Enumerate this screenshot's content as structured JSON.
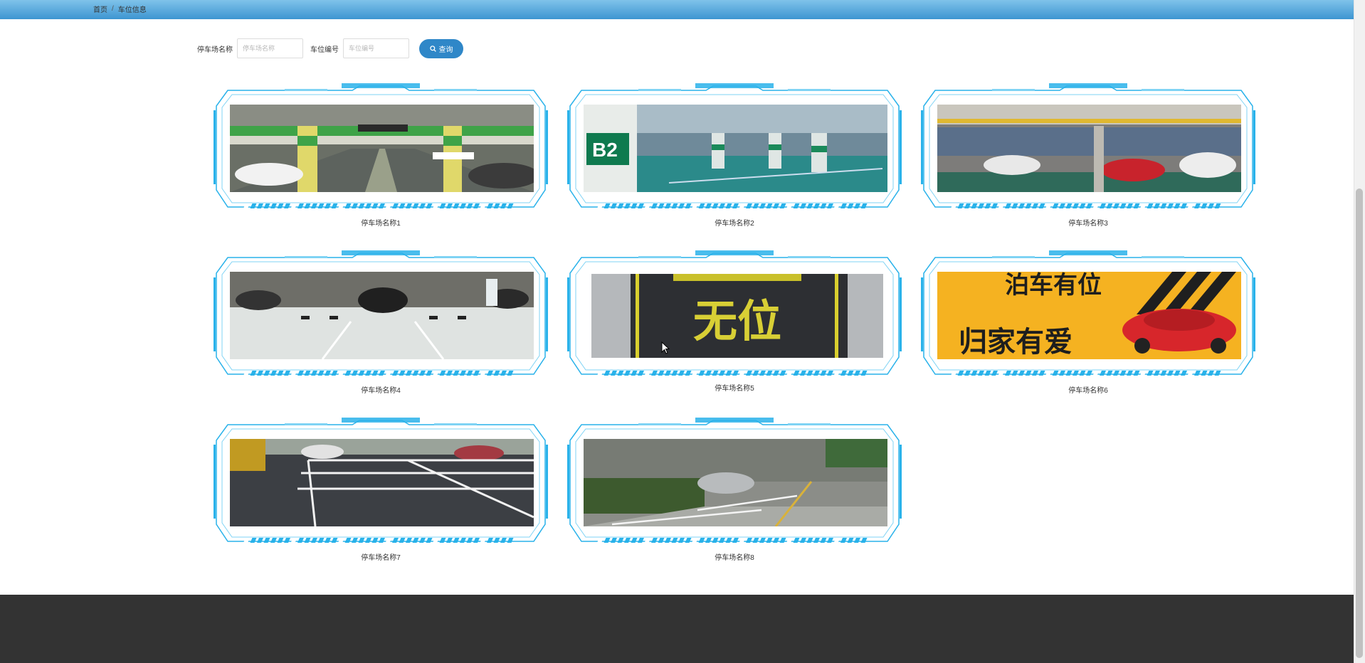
{
  "breadcrumb": {
    "home": "首页",
    "separator": "/",
    "current": "车位信息"
  },
  "search": {
    "lot_name_label": "停车场名称",
    "lot_name_placeholder": "停车场名称",
    "space_no_label": "车位编号",
    "space_no_placeholder": "车位编号",
    "button_label": "查询",
    "button_icon": "search-icon"
  },
  "cards": [
    {
      "name": "停车场名称1",
      "scene": "underground-green-pillars"
    },
    {
      "name": "停车场名称2",
      "scene": "underground-b2"
    },
    {
      "name": "停车场名称3",
      "scene": "garage-yellow-pipes"
    },
    {
      "name": "停车场名称4",
      "scene": "garage-white-floor"
    },
    {
      "name": "停车场名称5",
      "scene": "no-space-sign",
      "sign_text": "无位"
    },
    {
      "name": "停车场名称6",
      "scene": "banner-red-car",
      "banner_text_top": "泊车有位",
      "banner_text_bottom": "归家有爱"
    },
    {
      "name": "停车场名称7",
      "scene": "outdoor-lot"
    },
    {
      "name": "停车场名称8",
      "scene": "outdoor-wall-lot"
    }
  ],
  "colors": {
    "topbar": "#3d95d1",
    "accent": "#2f87c8",
    "frame": "#29b2ea",
    "footer": "#333333"
  }
}
